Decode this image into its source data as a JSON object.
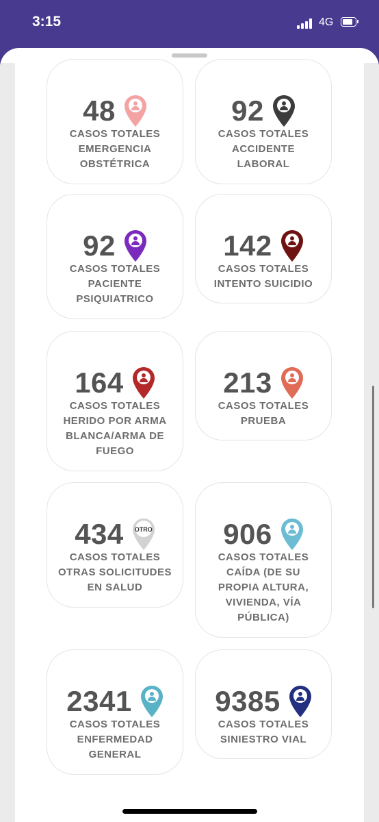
{
  "status_bar": {
    "time": "3:15",
    "network": "4G"
  },
  "cards": [
    {
      "number": "48",
      "lines": [
        "CASOS TOTALES",
        "EMERGENCIA",
        "OBSTÉTRICA"
      ],
      "color": "#f3a3a3",
      "icon": "pregnant-woman-icon"
    },
    {
      "number": "92",
      "lines": [
        "CASOS TOTALES",
        "ACCIDENTE",
        "LABORAL"
      ],
      "color": "#3c3c3c",
      "icon": "worker-icon"
    },
    {
      "number": "92",
      "lines": [
        "CASOS TOTALES",
        "PACIENTE",
        "PSIQUIATRICO"
      ],
      "color": "#7a2bbd",
      "icon": "head-icon"
    },
    {
      "number": "142",
      "lines": [
        "CASOS TOTALES",
        "INTENTO SUICIDIO"
      ],
      "color": "#6e1212",
      "icon": "noose-icon"
    },
    {
      "number": "164",
      "lines": [
        "CASOS TOTALES",
        "HERIDO POR ARMA",
        "BLANCA/ARMA DE",
        "FUEGO"
      ],
      "color": "#b32828",
      "icon": "weapon-icon"
    },
    {
      "number": "213",
      "lines": [
        "CASOS TOTALES",
        "PRUEBA"
      ],
      "color": "#e06b56",
      "icon": "baby-icon"
    },
    {
      "number": "434",
      "lines": [
        "CASOS TOTALES",
        "OTRAS SOLICITUDES",
        "EN SALUD"
      ],
      "color": "#d2d2d2",
      "icon": "otro-icon",
      "icon_text": "OTRO"
    },
    {
      "number": "906",
      "lines": [
        "CASOS TOTALES",
        "CAÍDA (DE SU",
        "PROPIA ALTURA,",
        "VIVIENDA, VÍA",
        "PÚBLICA)"
      ],
      "color": "#6cbcd3",
      "icon": "fall-person-icon"
    },
    {
      "number": "2341",
      "lines": [
        "CASOS TOTALES",
        "ENFERMEDAD",
        "GENERAL"
      ],
      "color": "#5ab2c6",
      "icon": "sick-person-icon"
    },
    {
      "number": "9385",
      "lines": [
        "CASOS TOTALES",
        "SINIESTRO VIAL"
      ],
      "color": "#233080",
      "icon": "car-crash-icon"
    }
  ]
}
